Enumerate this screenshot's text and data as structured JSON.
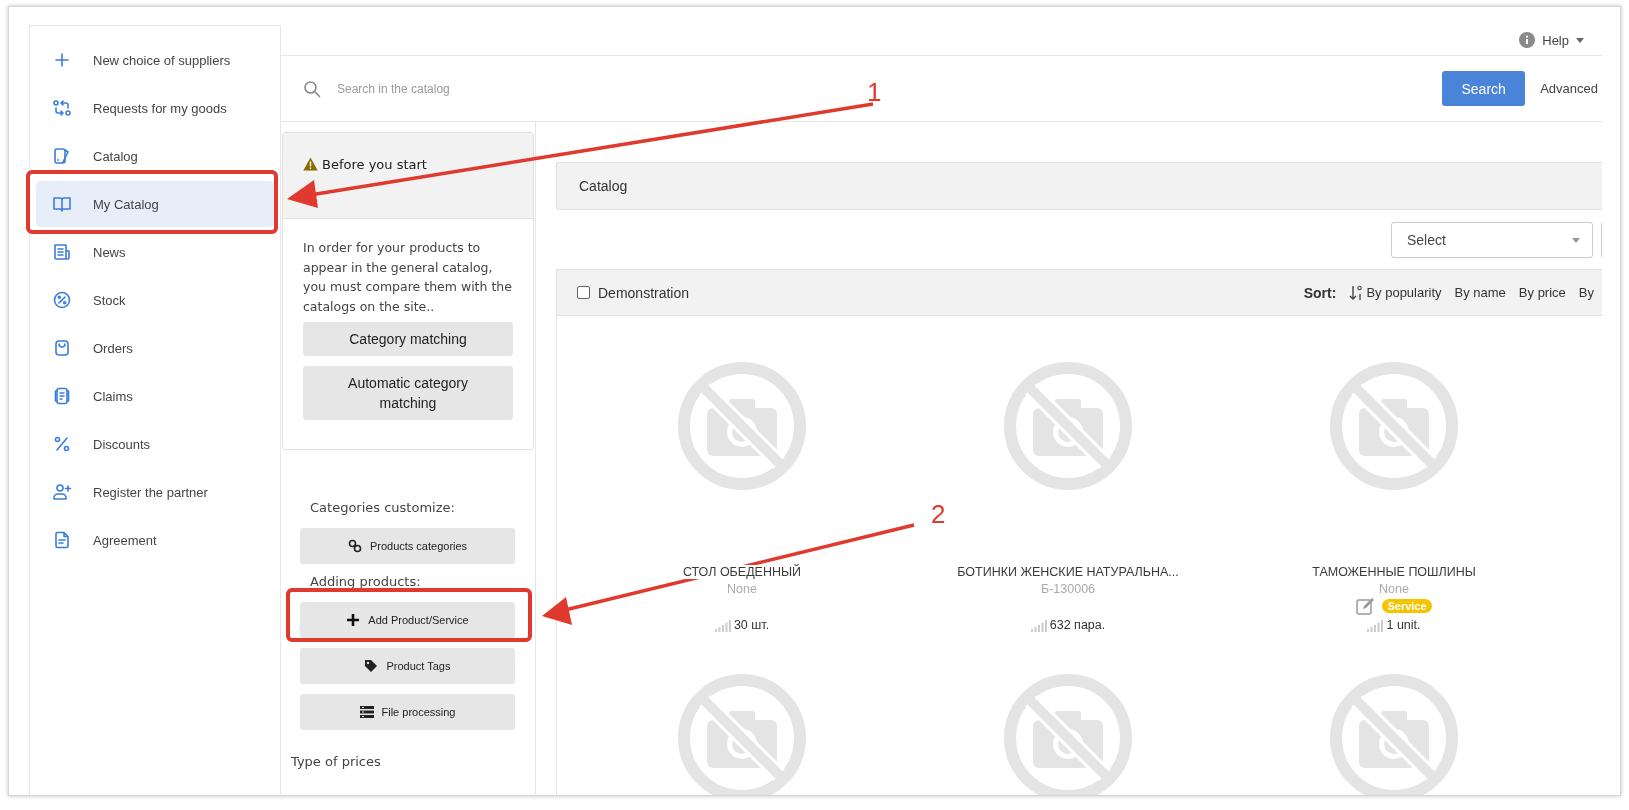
{
  "sidebar": {
    "items": [
      {
        "label": "New choice of suppliers",
        "selected": false
      },
      {
        "label": "Requests for my goods",
        "selected": false
      },
      {
        "label": "Catalog",
        "selected": false
      },
      {
        "label": "My Catalog",
        "selected": true
      },
      {
        "label": "News",
        "selected": false
      },
      {
        "label": "Stock",
        "selected": false
      },
      {
        "label": "Orders",
        "selected": false
      },
      {
        "label": "Claims",
        "selected": false
      },
      {
        "label": "Discounts",
        "selected": false
      },
      {
        "label": "Register the partner",
        "selected": false
      },
      {
        "label": "Agreement",
        "selected": false
      }
    ]
  },
  "header": {
    "help": "Help"
  },
  "search": {
    "placeholder": "Search in the catalog",
    "button": "Search",
    "advanced_link": "Advanced"
  },
  "before_you_start": {
    "title": "Before you start",
    "text": "In order for your products to appear in the general catalog, you must compare them with the catalogs on the site..",
    "buttons": [
      "Category matching",
      "Automatic category matching"
    ]
  },
  "tools": {
    "sections": [
      {
        "heading": "Categories customize:",
        "buttons": [
          "Products categories"
        ]
      },
      {
        "heading": "Adding products:",
        "buttons": [
          "Add Product/Service",
          "Product Tags",
          "File processing"
        ]
      }
    ],
    "type_of_prices": "Type of prices"
  },
  "catalog_bar": {
    "title": "Catalog"
  },
  "filter": {
    "select": "Select"
  },
  "list_bar": {
    "demonstration": {
      "label": "Demonstration",
      "checked": false
    },
    "sort_label": "Sort:",
    "sort_options": [
      {
        "label": "By popularity",
        "selected": true
      },
      {
        "label": "By name",
        "selected": false
      },
      {
        "label": "By price",
        "selected": false
      },
      {
        "label": "By",
        "selected": false
      }
    ]
  },
  "products": [
    {
      "kind": "card",
      "name": "СТОЛ ОБЕДЕННЫЙ",
      "code": "None",
      "quantity": "30 шт."
    },
    {
      "kind": "card",
      "name": "БОТИНКИ ЖЕНСКИЕ НАТУРАЛЬНА...",
      "code": "Б-130006",
      "quantity": "632 пара."
    },
    {
      "kind": "card",
      "name": "ТАМОЖЕННЫЕ ПОШЛИНЫ",
      "code": "None",
      "badge": "Service",
      "quantity": "1 unit."
    },
    {
      "kind": "image-only"
    },
    {
      "kind": "image-only"
    },
    {
      "kind": "image-only"
    }
  ],
  "annotations": [
    {
      "number": "1"
    },
    {
      "number": "2"
    }
  ]
}
